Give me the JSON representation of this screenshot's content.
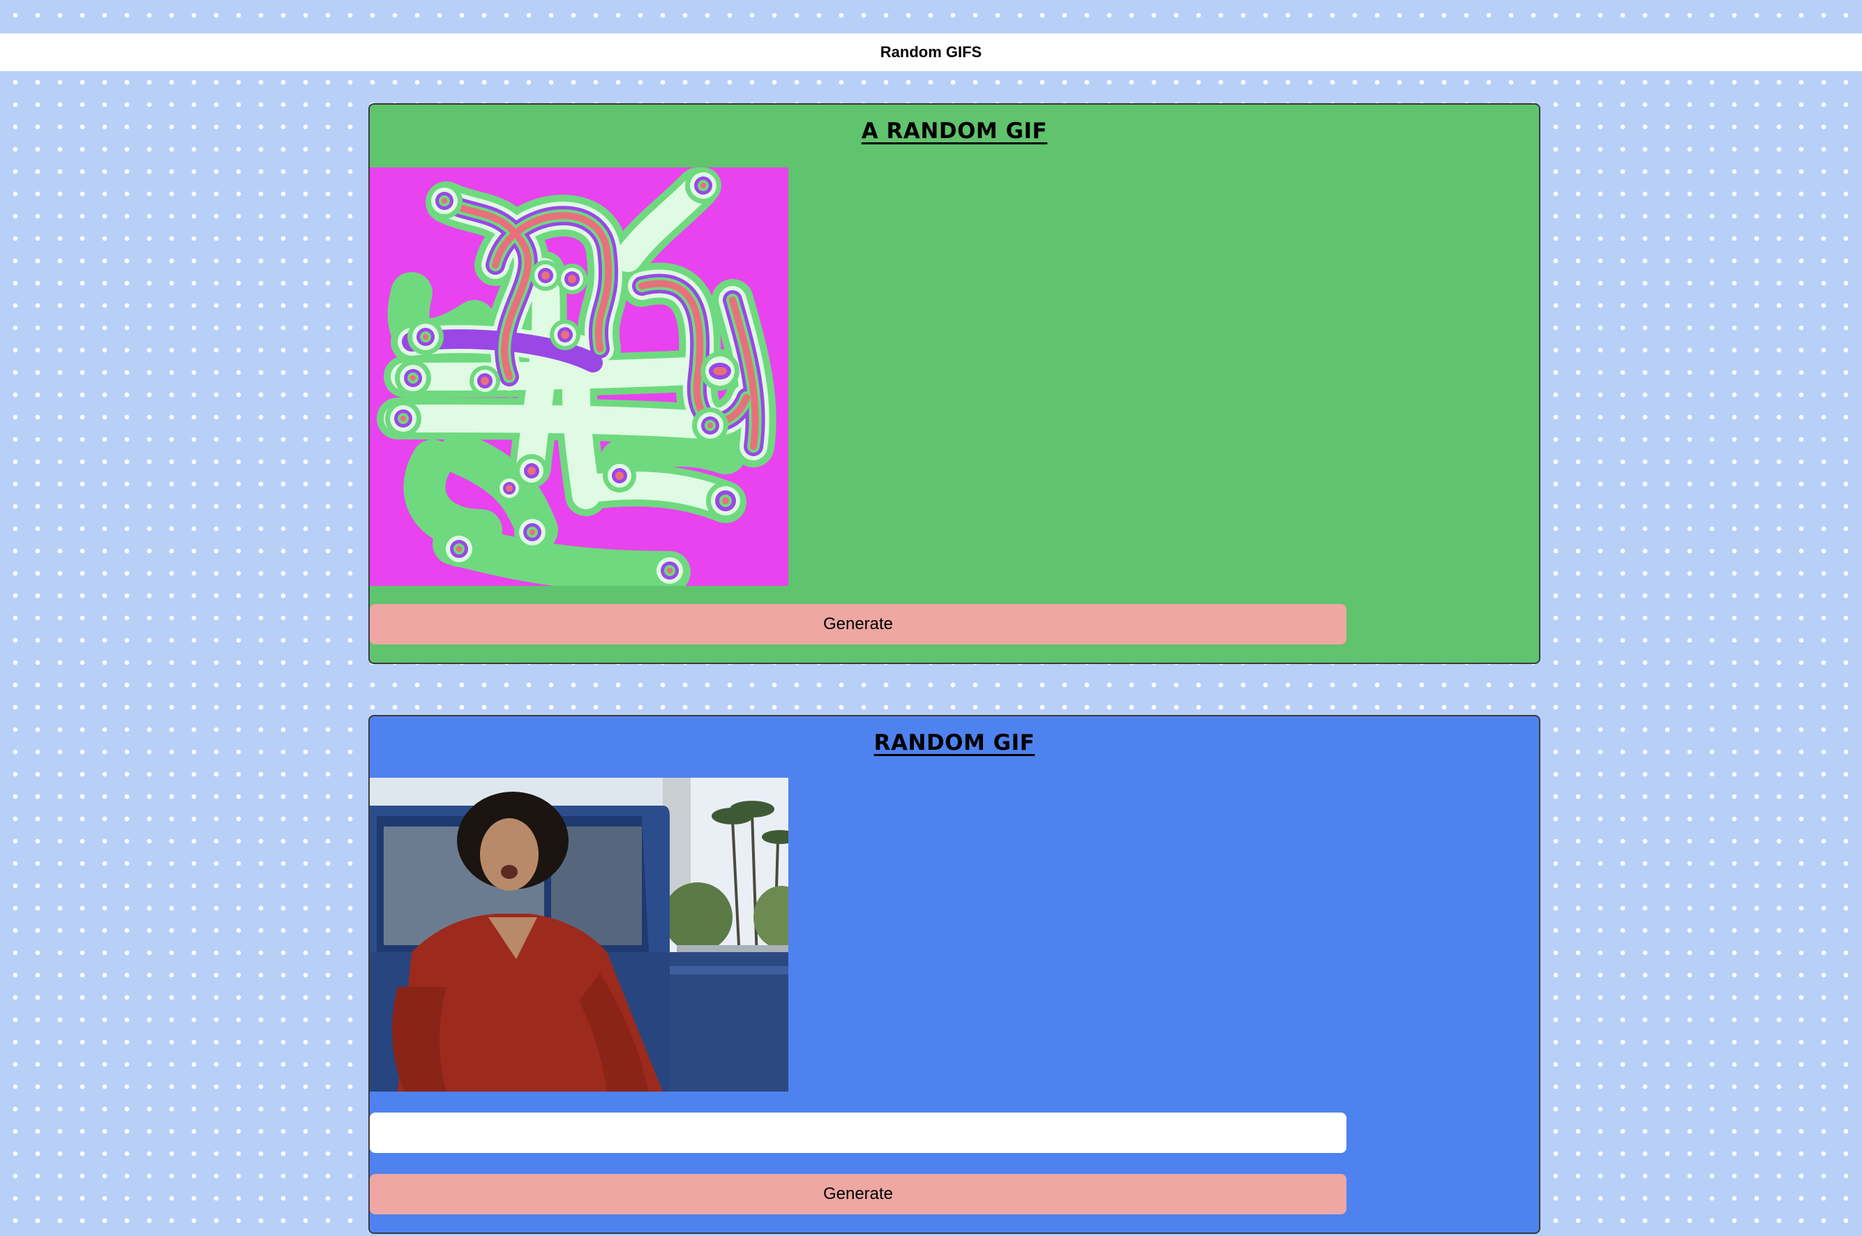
{
  "app": {
    "title": "Random GIFS"
  },
  "colors": {
    "page_background": "#b8d0f8",
    "navbar": "#ffffff",
    "random_card": "#60c36d",
    "tag_card": "#4e82ef",
    "button": "#eea7a3",
    "input": "#ffffff"
  },
  "random_card": {
    "title": "A RANDOM GIF",
    "gif_alt": "psychedelic tubes animation",
    "button_label": "Generate"
  },
  "tag_card": {
    "title": "RANDOM GIF",
    "gif_alt": "long-haired man in red shirt running past truck",
    "input_value": "",
    "input_placeholder": "",
    "button_label": "Generate"
  }
}
